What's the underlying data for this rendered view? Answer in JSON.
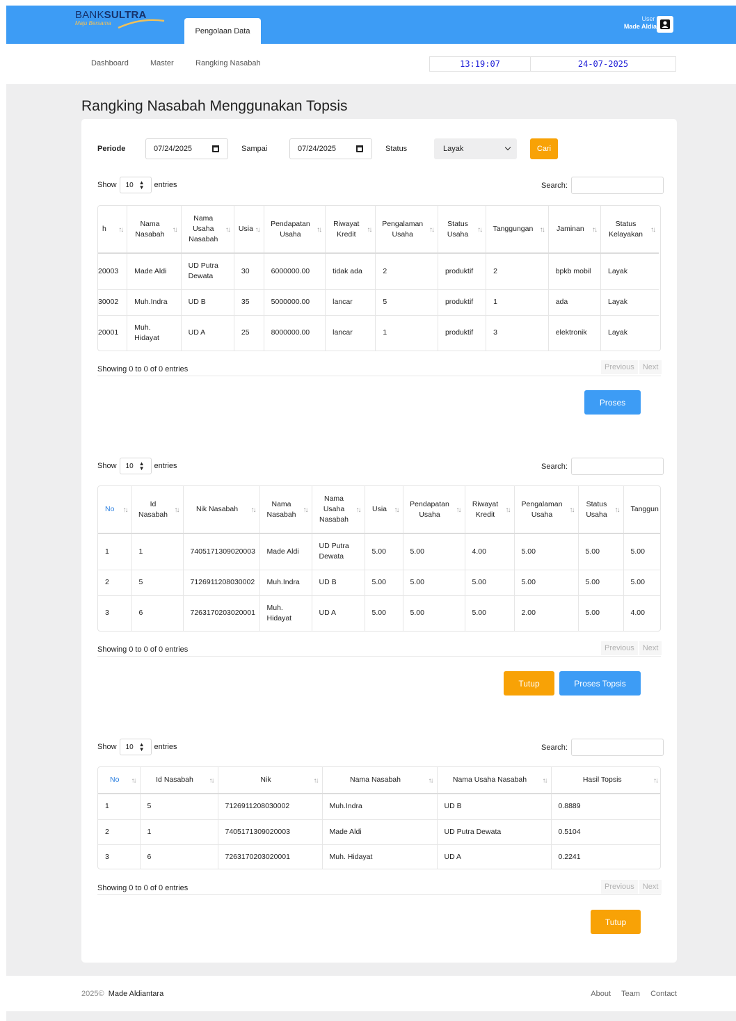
{
  "header": {
    "brand_main": "BANK",
    "brand_bold": "SULTRA",
    "tagline": "Maju Bersama",
    "active_tab": "Pengolaan Data",
    "user_label": "User Login",
    "user_name": "Made Aldiantara"
  },
  "subnav": {
    "items": [
      "Dashboard",
      "Master",
      "Rangking Nasabah"
    ],
    "time": "13:19:07",
    "date": "24-07-2025"
  },
  "page_title": "Rangking Nasabah Menggunakan Topsis",
  "filter": {
    "periode_label": "Periode",
    "from": "07/24/2025",
    "sampai_label": "Sampai",
    "to": "07/24/2025",
    "status_label": "Status",
    "status_value": "Layak",
    "cari": "Cari"
  },
  "datatable": {
    "show": "Show",
    "length": "10",
    "entries": "entries",
    "search": "Search:",
    "info": "Showing 0 to 0 of 0 entries",
    "previous": "Previous",
    "next": "Next"
  },
  "table1": {
    "headers": [
      "h",
      "Nama Nasabah",
      "Nama Usaha Nasabah",
      "Usia",
      "Pendapatan Usaha",
      "Riwayat Kredit",
      "Pengalaman Usaha",
      "Status Usaha",
      "Tanggungan",
      "Jaminan",
      "Status Kelayakan"
    ],
    "rows": [
      [
        "20003",
        "Made Aldi",
        "UD Putra Dewata",
        "30",
        "6000000.00",
        "tidak ada",
        "2",
        "produktif",
        "2",
        "bpkb mobil",
        "Layak"
      ],
      [
        "30002",
        "Muh.Indra",
        "UD B",
        "35",
        "5000000.00",
        "lancar",
        "5",
        "produktif",
        "1",
        "ada",
        "Layak"
      ],
      [
        "20001",
        "Muh. Hidayat",
        "UD A",
        "25",
        "8000000.00",
        "lancar",
        "1",
        "produktif",
        "3",
        "elektronik",
        "Layak"
      ]
    ],
    "button": "Proses"
  },
  "table2": {
    "headers": [
      "No",
      "Id Nasabah",
      "Nik Nasabah",
      "Nama Nasabah",
      "Nama Usaha Nasabah",
      "Usia",
      "Pendapatan Usaha",
      "Riwayat Kredit",
      "Pengalaman Usaha",
      "Status Usaha",
      "Tanggun"
    ],
    "rows": [
      [
        "1",
        "1",
        "7405171309020003",
        "Made Aldi",
        "UD Putra Dewata",
        "5.00",
        "5.00",
        "4.00",
        "5.00",
        "5.00",
        "5.00"
      ],
      [
        "2",
        "5",
        "7126911208030002",
        "Muh.Indra",
        "UD B",
        "5.00",
        "5.00",
        "5.00",
        "5.00",
        "5.00",
        "5.00"
      ],
      [
        "3",
        "6",
        "7263170203020001",
        "Muh. Hidayat",
        "UD A",
        "5.00",
        "5.00",
        "5.00",
        "2.00",
        "5.00",
        "4.00"
      ]
    ],
    "button_close": "Tutup",
    "button_topsis": "Proses Topsis"
  },
  "table3": {
    "headers": [
      "No",
      "Id Nasabah",
      "Nik",
      "Nama Nasabah",
      "Nama Usaha Nasabah",
      "Hasil Topsis"
    ],
    "rows": [
      [
        "1",
        "5",
        "7126911208030002",
        "Muh.Indra",
        "UD B",
        "0.8889"
      ],
      [
        "2",
        "1",
        "7405171309020003",
        "Made Aldi",
        "UD Putra Dewata",
        "0.5104"
      ],
      [
        "3",
        "6",
        "7263170203020001",
        "Muh. Hidayat",
        "UD A",
        "0.2241"
      ]
    ],
    "button_close": "Tutup"
  },
  "footer": {
    "copyright": "2025©",
    "owner": "Made Aldiantara",
    "links": [
      "About",
      "Team",
      "Contact"
    ]
  },
  "colors": {
    "primary": "#3d9cf5",
    "accent": "#f8a206",
    "navy": "#16326b"
  }
}
